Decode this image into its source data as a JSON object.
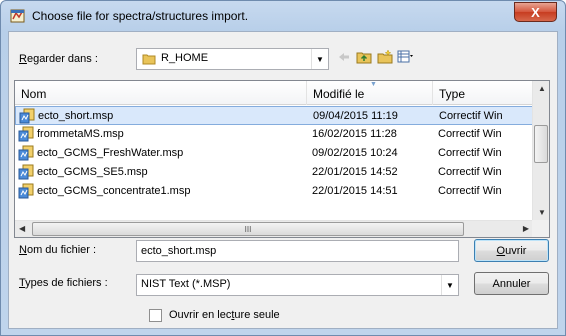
{
  "window": {
    "title": "Choose file for spectra/structures import.",
    "close_glyph": "X"
  },
  "toolbar": {
    "look_in_label_u": "R",
    "look_in_label_rest": "egarder dans :",
    "look_in_value": "R_HOME"
  },
  "columns": {
    "name": "Nom",
    "modified": "Modifié le",
    "type": "Type"
  },
  "files": [
    {
      "name": "ecto_short.msp",
      "modified": "09/04/2015 11:19",
      "type": "Correctif Win"
    },
    {
      "name": "frommetaMS.msp",
      "modified": "16/02/2015 11:28",
      "type": "Correctif Win"
    },
    {
      "name": "ecto_GCMS_FreshWater.msp",
      "modified": "09/02/2015 10:24",
      "type": "Correctif Win"
    },
    {
      "name": "ecto_GCMS_SE5.msp",
      "modified": "22/01/2015 14:52",
      "type": "Correctif Win"
    },
    {
      "name": "ecto_GCMS_concentrate1.msp",
      "modified": "22/01/2015 14:51",
      "type": "Correctif Win"
    }
  ],
  "filename": {
    "label_u": "N",
    "label_rest": "om du fichier :",
    "value": "ecto_short.msp"
  },
  "filetype": {
    "label_u": "T",
    "label_rest": "ypes de fichiers :",
    "value": "NIST Text (*.MSP)"
  },
  "buttons": {
    "open_u": "O",
    "open_rest": "uvrir",
    "cancel": "Annuler"
  },
  "readonly": {
    "label_pre": "Ouvrir en lec",
    "label_u": "t",
    "label_post": "ure seule"
  },
  "scroll": {
    "hthumb_grip": "III"
  }
}
